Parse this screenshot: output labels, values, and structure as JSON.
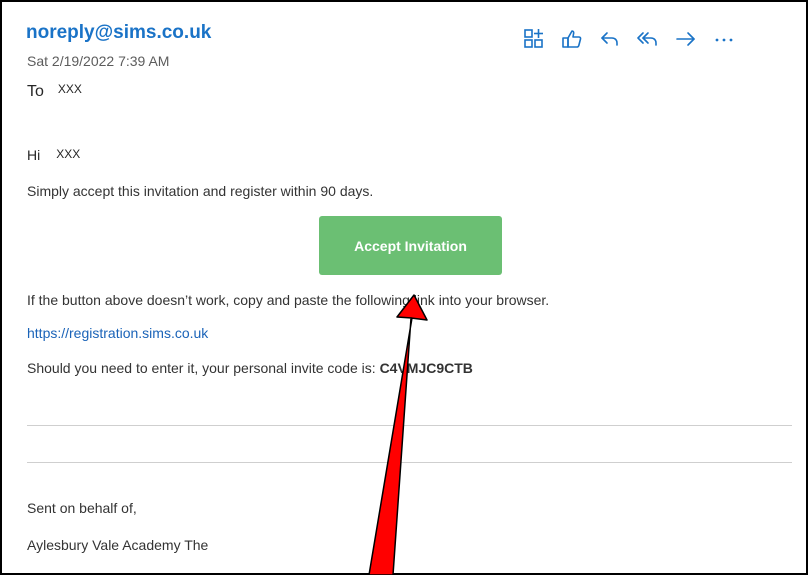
{
  "email": {
    "sender": "noreply@sims.co.uk",
    "date": "Sat 2/19/2022 7:39 AM",
    "to_label": "To",
    "to_value": "XXX",
    "greeting_label": "Hi",
    "greeting_name": "XXX",
    "intro_text": "Simply accept this invitation and register within 90 days.",
    "accept_button_label": "Accept Invitation",
    "fallback_text": "If the button above doesn’t work, copy and paste the following link into your browser.",
    "registration_link": "https://registration.sims.co.uk",
    "invite_code_text": "Should you need to enter it, your personal invite code is: ",
    "invite_code": "C4VMJC9CTB",
    "signoff": "Sent on behalf of,",
    "organization": "Aylesbury Vale Academy The"
  },
  "toolbar": {
    "icons": [
      "apps-add-icon",
      "like-icon",
      "reply-icon",
      "reply-all-icon",
      "forward-icon",
      "more-icon"
    ]
  },
  "colors": {
    "link": "#1a73c7",
    "accept_button": "#6bbf73",
    "annotation_arrow": "#ff0000"
  }
}
